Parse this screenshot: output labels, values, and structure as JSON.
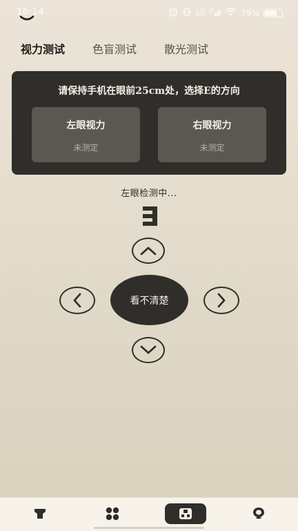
{
  "status_bar": {
    "time": "16:14",
    "battery_text": "79%",
    "battery_level": 0.79,
    "net_speed_top": "9.30",
    "net_speed_bottom": "KB/s",
    "network_label": "5G",
    "icons": [
      "alarm-icon",
      "vibrate-icon",
      "signal-icon",
      "wifi-icon",
      "battery-icon"
    ]
  },
  "tabs": [
    {
      "label": "视力测试",
      "active": true
    },
    {
      "label": "色盲测试",
      "active": false
    },
    {
      "label": "散光测试",
      "active": false
    }
  ],
  "card": {
    "instruction": "请保持手机在眼前25cm处，选择E的方向",
    "left_eye": {
      "label": "左眼视力",
      "value": "未测定"
    },
    "right_eye": {
      "label": "右眼视力",
      "value": "未测定"
    }
  },
  "test": {
    "status": "左眼检测中...",
    "e_direction": "left",
    "cant_see_label": "看不清楚"
  },
  "controls": {
    "up_icon": "chevron-up-icon",
    "down_icon": "chevron-down-icon",
    "left_icon": "chevron-left-icon",
    "right_icon": "chevron-right-icon"
  },
  "bottom_nav": {
    "items": [
      {
        "icon": "flashlight-icon",
        "active": false
      },
      {
        "icon": "grid-icon",
        "active": false
      },
      {
        "icon": "eye-chart-icon",
        "active": true
      },
      {
        "icon": "mirror-icon",
        "active": false
      }
    ]
  },
  "colors": {
    "dark": "#2f2e2a",
    "card_inner": "#5a5850",
    "background": "#e3dbcb"
  }
}
